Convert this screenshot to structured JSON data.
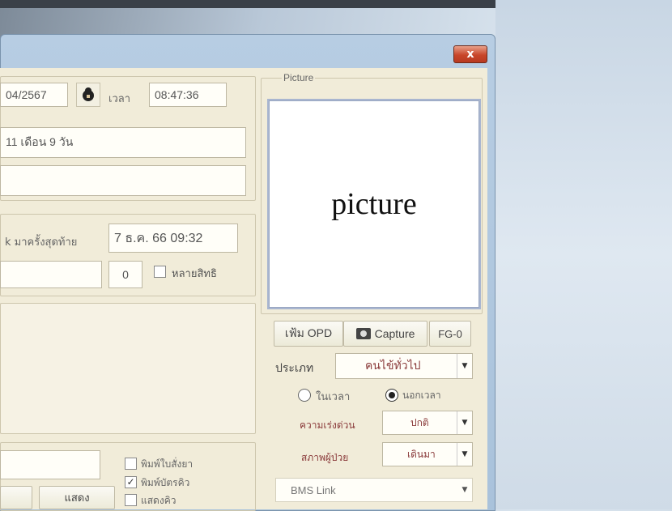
{
  "window": {
    "close_label": "x"
  },
  "header": {
    "date_value": "04/2567",
    "time_label": "เวลา",
    "time_value": "08:47:36"
  },
  "patient": {
    "age_value": "11 เดือน 9 วัน",
    "blank_value": ""
  },
  "visit": {
    "last_visit_label": "k มาครั้งสุดท้าย",
    "last_visit_value": "7 ธ.ค. 66 09:32",
    "count_value": "0",
    "multi_rights_label": "หลายสิทธิ"
  },
  "picture": {
    "group_label": "Picture",
    "placeholder": "picture"
  },
  "toolbar": {
    "opd_label": "เฟ้ม OPD",
    "capture_label": "Capture",
    "fg_label": "FG-0"
  },
  "type": {
    "label": "ประเภท",
    "value": "คนไข้ทั่วไป"
  },
  "time_mode": {
    "in_hours_label": "ในเวลา",
    "out_hours_label": "นอกเวลา",
    "selected": "นอกเวลา"
  },
  "urgency": {
    "label": "ความเร่งด่วน",
    "value": "ปกติ"
  },
  "condition": {
    "label": "สภาพผู้ป่วย",
    "value": "เดินมา"
  },
  "bms": {
    "value": "BMS Link"
  },
  "bottom": {
    "show_button": "แสดง",
    "print_drug_label": "พิมพ์ใบสั่งยา",
    "print_queue_label": "พิมพ์บัตรคิว",
    "show_queue_label": "แสดงคิว"
  },
  "colors": {
    "close_red": "#c8462a",
    "panel_bg": "#f1ecd9"
  }
}
